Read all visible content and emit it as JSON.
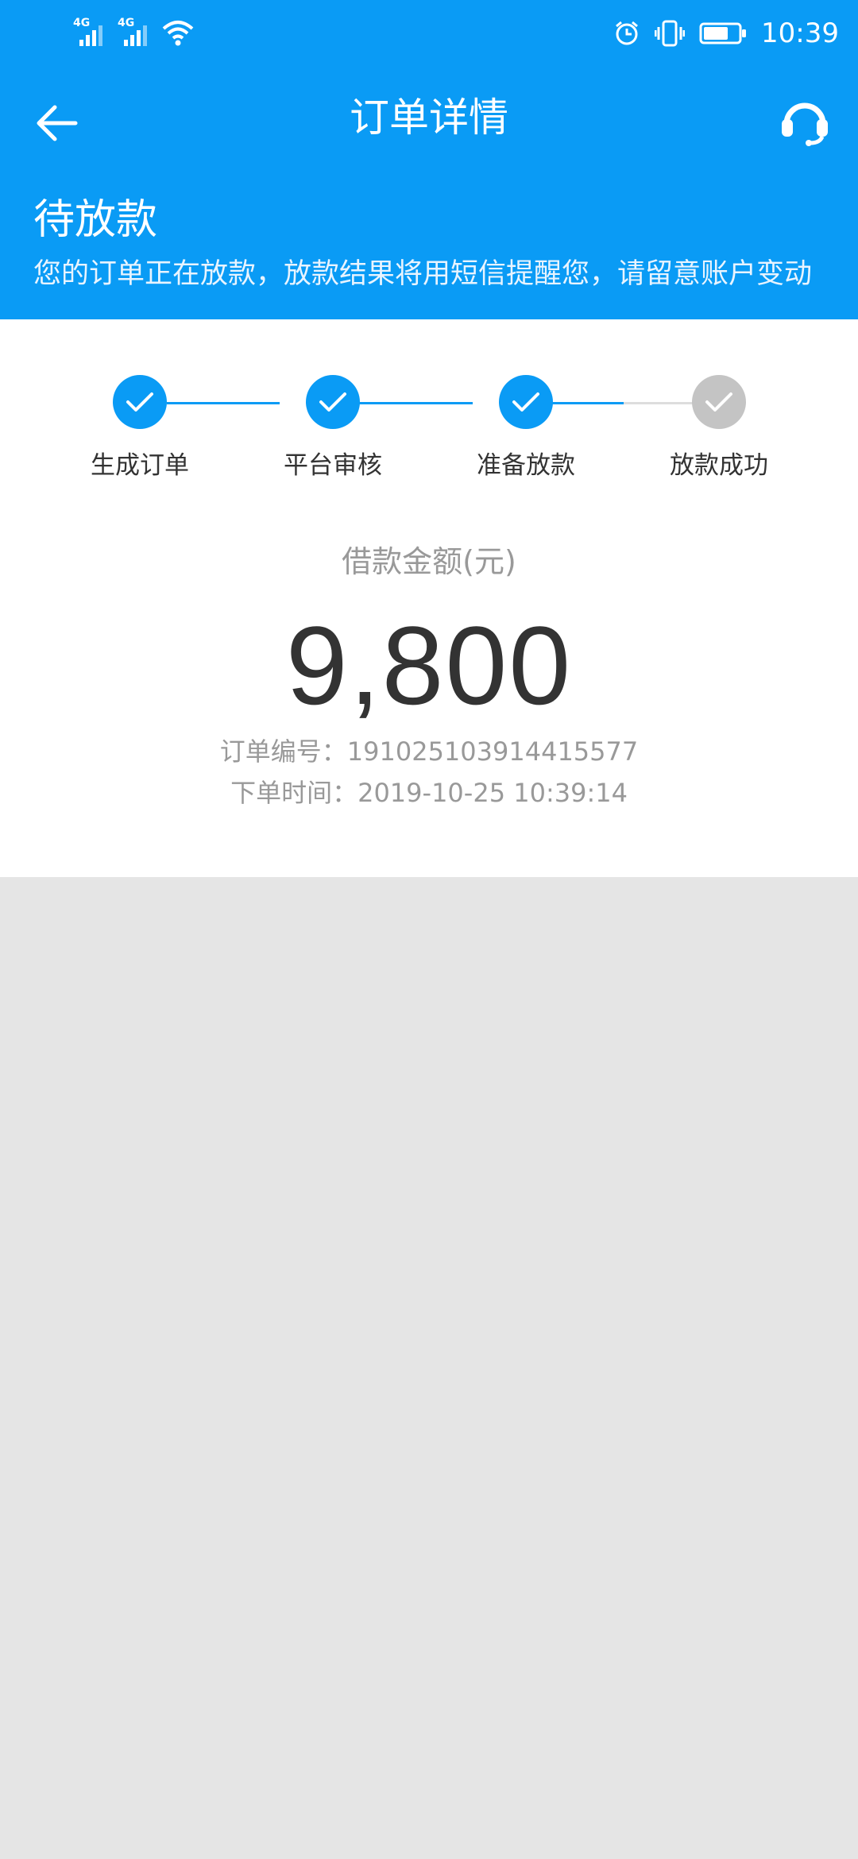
{
  "colors": {
    "primary": "#0a9bf5",
    "inactive_step": "#c4c4c4",
    "text_dark": "#333333",
    "text_muted": "#999999",
    "page_bg": "#e5e5e5"
  },
  "status_bar": {
    "network1": "4G",
    "network2": "4G",
    "time": "10:39",
    "icons": [
      "signal-icon",
      "signal-icon",
      "wifi-icon",
      "alarm-icon",
      "vibrate-icon",
      "battery-icon"
    ]
  },
  "header": {
    "title": "订单详情",
    "back_icon": "arrow-left-icon",
    "support_icon": "headset-icon"
  },
  "order_status": {
    "title": "待放款",
    "description": "您的订单正在放款，放款结果将用短信提醒您，请留意账户变动"
  },
  "steps": [
    {
      "label": "生成订单",
      "done": true
    },
    {
      "label": "平台审核",
      "done": true
    },
    {
      "label": "准备放款",
      "done": true
    },
    {
      "label": "放款成功",
      "done": false
    }
  ],
  "loan": {
    "amount_label": "借款金额(元)",
    "amount": "9,800",
    "order_no_label": "订单编号：",
    "order_no": "191025103914415577",
    "order_time_label": "下单时间：",
    "order_time": "2019-10-25 10:39:14"
  }
}
